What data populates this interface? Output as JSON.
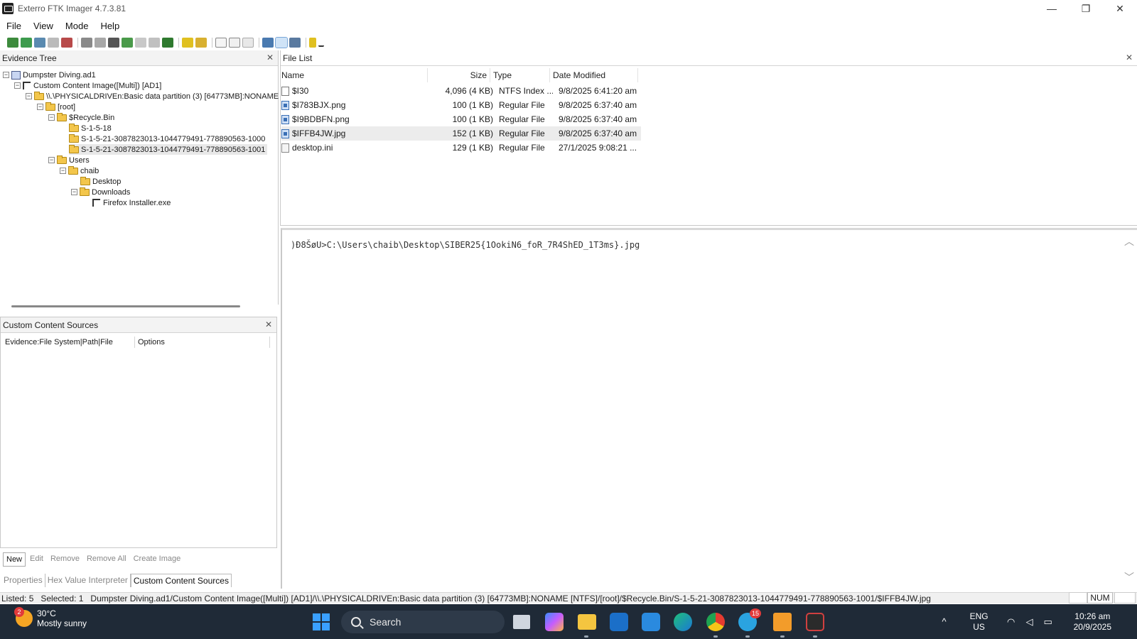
{
  "window": {
    "title": "Exterro FTK Imager 4.7.3.81",
    "minimize": "—",
    "restore": "❐",
    "close": "✕"
  },
  "menu": [
    "File",
    "View",
    "Mode",
    "Help"
  ],
  "panels": {
    "evidence_tree": "Evidence Tree",
    "file_list": "File List",
    "custom_content": "Custom Content Sources",
    "close": "✕"
  },
  "tree": [
    {
      "label": "Dumpster Diving.ad1",
      "exp": "⊟",
      "icon": "image"
    },
    {
      "label": "Custom Content Image([Multi]) [AD1]",
      "exp": "⊟",
      "icon": "partition"
    },
    {
      "label": "\\\\.\\PHYSICALDRIVEn:Basic data partition (3) [64773MB]:NONAME [NTFS]",
      "exp": "⊟",
      "icon": "folder"
    },
    {
      "label": "[root]",
      "exp": "⊟",
      "icon": "folder"
    },
    {
      "label": "$Recycle.Bin",
      "exp": "⊟",
      "icon": "folder"
    },
    {
      "label": "S-1-5-18",
      "exp": "",
      "icon": "folder"
    },
    {
      "label": "S-1-5-21-3087823013-1044779491-778890563-1000",
      "exp": "",
      "icon": "folder"
    },
    {
      "label": "S-1-5-21-3087823013-1044779491-778890563-1001",
      "exp": "",
      "icon": "folder"
    },
    {
      "label": "Users",
      "exp": "⊟",
      "icon": "folder"
    },
    {
      "label": "chaib",
      "exp": "⊟",
      "icon": "folder"
    },
    {
      "label": "Desktop",
      "exp": "",
      "icon": "folder"
    },
    {
      "label": "Downloads",
      "exp": "⊟",
      "icon": "folder"
    },
    {
      "label": "Firefox Installer.exe",
      "exp": "",
      "icon": "partition"
    }
  ],
  "file_list": {
    "columns": [
      "Name",
      "Size",
      "Type",
      "Date Modified"
    ],
    "rows": [
      {
        "name": "$I30",
        "size": "4,096 (4 KB)",
        "type": "NTFS Index ...",
        "date": "9/8/2025 6:41:20 am",
        "icon": "doc"
      },
      {
        "name": "$I783BJX.png",
        "size": "100 (1 KB)",
        "type": "Regular File",
        "date": "9/8/2025 6:37:40 am",
        "icon": "img"
      },
      {
        "name": "$I9BDBFN.png",
        "size": "100 (1 KB)",
        "type": "Regular File",
        "date": "9/8/2025 6:37:40 am",
        "icon": "img"
      },
      {
        "name": "$IFFB4JW.jpg",
        "size": "152 (1 KB)",
        "type": "Regular File",
        "date": "9/8/2025 6:37:40 am",
        "icon": "img"
      },
      {
        "name": "desktop.ini",
        "size": "129 (1 KB)",
        "type": "Regular File",
        "date": "27/1/2025 9:08:21 ...",
        "icon": "ini"
      }
    ]
  },
  "viewer": {
    "text": ")Ð8ŠøU>C:\\Users\\chaib\\Desktop\\SIBER25{1OokiN6_foR_7R4ShED_1T3ms}.jpg",
    "scroll_up": "︿",
    "scroll_down": "﹀"
  },
  "custom_content": {
    "columns": [
      "Evidence:File System|Path|File",
      "Options"
    ],
    "buttons": [
      "New",
      "Edit",
      "Remove",
      "Remove All",
      "Create Image"
    ]
  },
  "bottom_tabs": [
    "Properties",
    "Hex Value Interpreter",
    "Custom Content Sources"
  ],
  "status": {
    "text": "Listed: 5   Selected: 1   Dumpster Diving.ad1/Custom Content Image([Multi]) [AD1]/\\\\.\\PHYSICALDRIVEn:Basic data partition (3) [64773MB]:NONAME [NTFS]/[root]/$Recycle.Bin/S-1-5-21-3087823013-1044779491-778890563-1001/$IFFB4JW.jpg",
    "num": "NUM"
  },
  "taskbar": {
    "weather_temp": "30°C",
    "weather_desc": "Mostly sunny",
    "weather_badge": "2",
    "search": "Search",
    "telegram_badge": "15",
    "chevron": "^",
    "lang_1": "ENG",
    "lang_2": "US",
    "time": "10:26 am",
    "date": "20/9/2025"
  }
}
